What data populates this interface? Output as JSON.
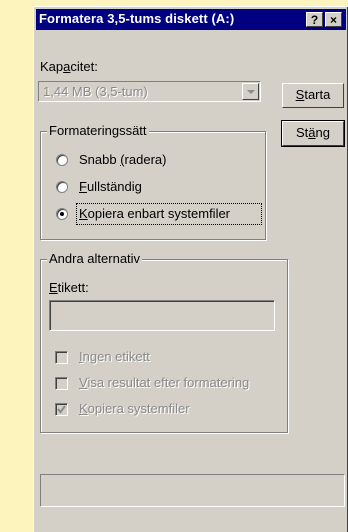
{
  "window": {
    "title": "Formatera 3,5-tums diskett (A:)",
    "help_button": "?",
    "close_button": "×"
  },
  "capacity": {
    "label_pre": "Kap",
    "label_key": "a",
    "label_post": "citet:",
    "value": "1,44 MB (3,5-tum)"
  },
  "buttons": {
    "start_key": "S",
    "start_rest": "tarta",
    "close_pre": "St",
    "close_key": "ä",
    "close_post": "ng"
  },
  "format_type": {
    "title": "Formateringssätt",
    "options": [
      {
        "pre": "Snabb ",
        "key": "(",
        "post": "radera)",
        "selected": false
      },
      {
        "pre": "",
        "key": "F",
        "post": "ullständig",
        "selected": false
      },
      {
        "pre": "",
        "key": "K",
        "post": "opiera enbart systemfiler",
        "selected": true
      }
    ]
  },
  "other_options": {
    "title": "Andra alternativ",
    "label_key": "E",
    "label_rest": "tikett:",
    "label_value": "",
    "checkboxes": [
      {
        "pre": "",
        "key": "I",
        "post": "ngen etikett",
        "checked": false
      },
      {
        "pre": "",
        "key": "V",
        "post": "isa resultat efter formatering",
        "checked": false
      },
      {
        "pre": "",
        "key": "K",
        "post": "opiera systemfiler",
        "checked": true
      }
    ]
  },
  "progress": {
    "value": 0
  }
}
